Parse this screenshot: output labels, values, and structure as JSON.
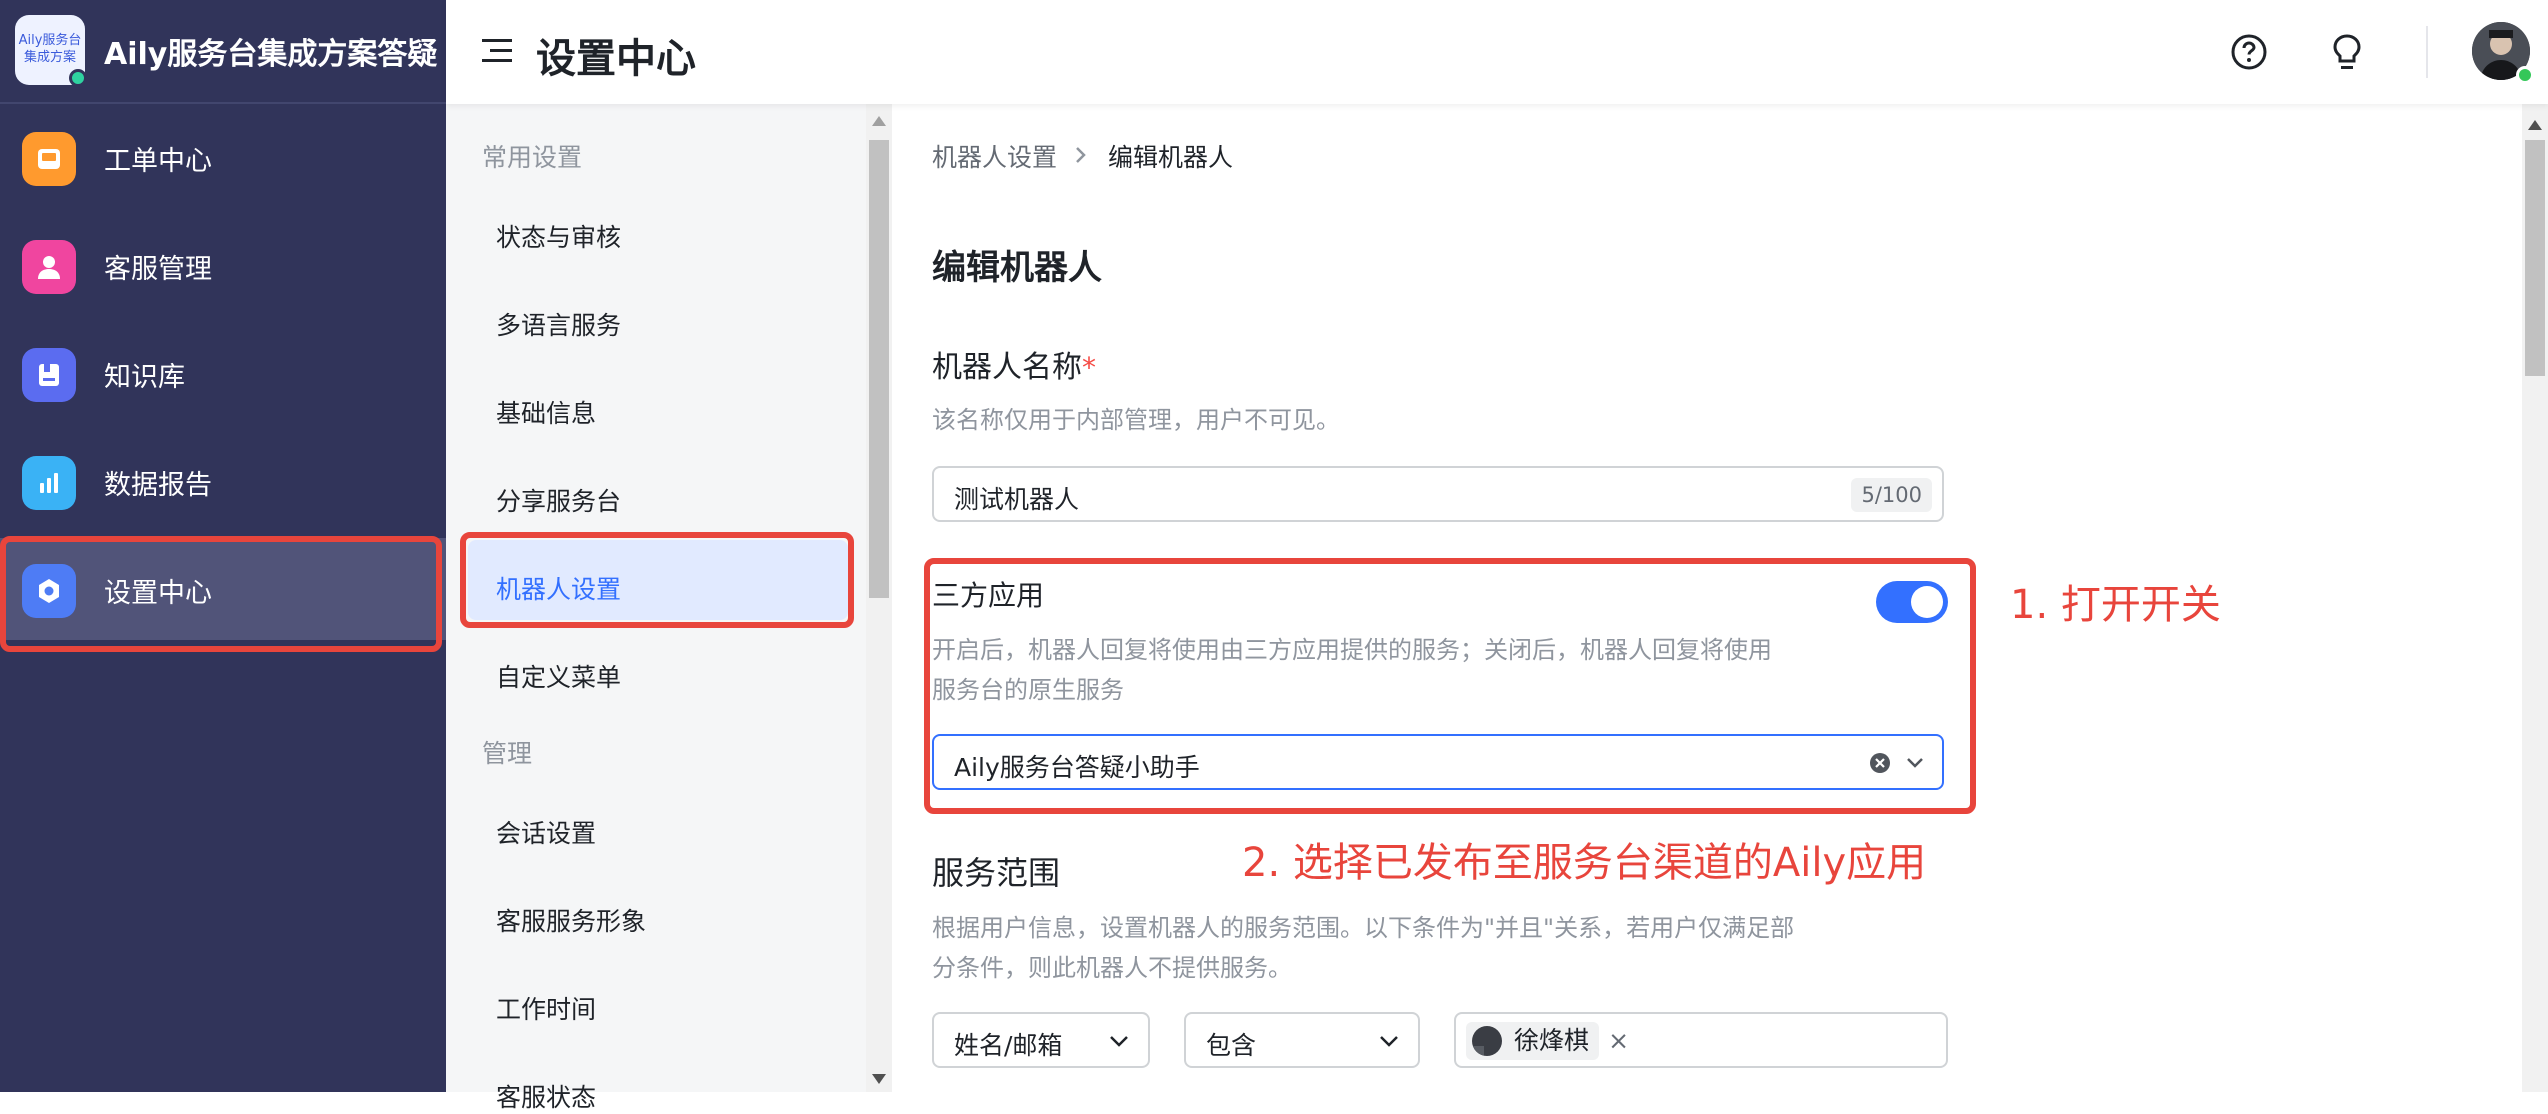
{
  "app": {
    "logo_text": "Aily服务台集成方案",
    "title": "Aily服务台集成方案答疑"
  },
  "nav": [
    {
      "label": "工单中心"
    },
    {
      "label": "客服管理"
    },
    {
      "label": "知识库"
    },
    {
      "label": "数据报告"
    },
    {
      "label": "设置中心"
    }
  ],
  "header": {
    "title": "设置中心"
  },
  "subnav": {
    "group1": "常用设置",
    "items1": [
      "状态与审核",
      "多语言服务",
      "基础信息",
      "分享服务台",
      "机器人设置",
      "自定义菜单"
    ],
    "group2": "管理",
    "items2": [
      "会话设置",
      "客服服务形象",
      "工作时间",
      "客服状态"
    ]
  },
  "breadcrumb": {
    "parent": "机器人设置",
    "current": "编辑机器人"
  },
  "form": {
    "heading": "编辑机器人",
    "name_label": "机器人名称",
    "required_mark": "*",
    "name_desc": "该名称仅用于内部管理，用户不可见。",
    "name_value": "测试机器人",
    "name_counter": "5/100",
    "third_party_label": "三方应用",
    "third_party_desc_line1": "开启后，机器人回复将使用由三方应用提供的服务；关闭后，机器人回复将使用",
    "third_party_desc_line2": "服务台的原生服务",
    "third_party_enabled": true,
    "third_party_app": "Aily服务台答疑小助手",
    "scope_label": "服务范围",
    "scope_desc_line1": "根据用户信息，设置机器人的服务范围。以下条件为\"并且\"关系，若用户仅满足部",
    "scope_desc_line2": "分条件，则此机器人不提供服务。",
    "scope_field": "姓名/邮箱",
    "scope_operator": "包含",
    "scope_tag": "徐烽棋"
  },
  "annotations": {
    "step1": "1. 打开开关",
    "step2": "2. 选择已发布至服务台渠道的Aily应用"
  },
  "colors": {
    "accent": "#3370ff",
    "annotation": "#e8453c",
    "sidebar": "#31345a"
  }
}
